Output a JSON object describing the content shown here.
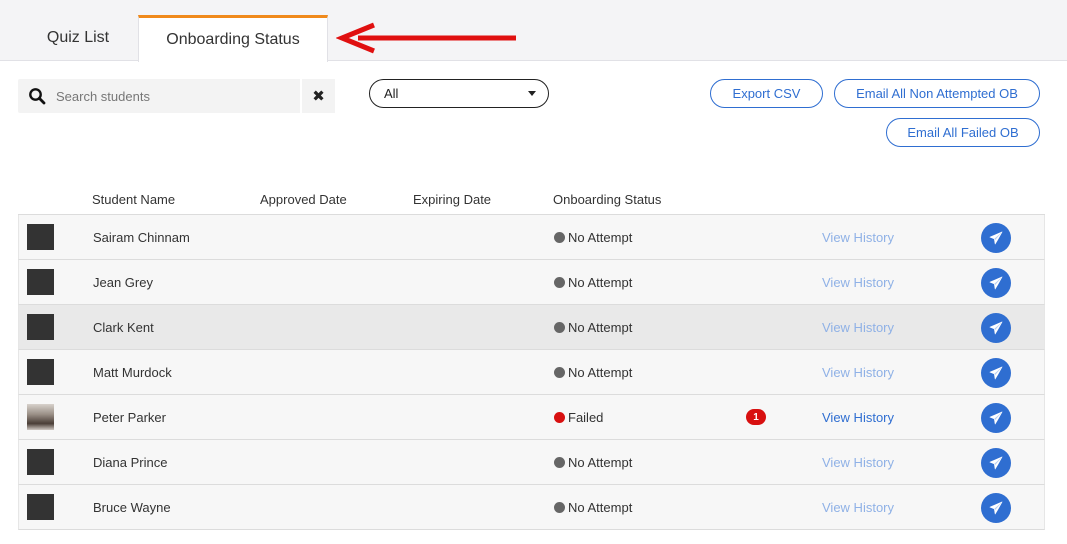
{
  "tabs": [
    {
      "label": "Quiz List",
      "active": false
    },
    {
      "label": "Onboarding Status",
      "active": true
    }
  ],
  "search": {
    "placeholder": "Search students",
    "value": "",
    "clear_icon": "close-icon"
  },
  "filter": {
    "selected": "All"
  },
  "actions": {
    "export_csv": "Export CSV",
    "email_non_attempted": "Email All Non Attempted OB",
    "email_failed": "Email All Failed OB"
  },
  "table": {
    "headers": [
      "Student Name",
      "Approved Date",
      "Expiring Date",
      "Onboarding Status"
    ],
    "rows": [
      {
        "name": "Sairam Chinnam",
        "approved": "",
        "expiring": "",
        "status": "No Attempt",
        "status_color": "#666666",
        "history": "View History",
        "history_active": false,
        "badge": "",
        "avatar": "placeholder"
      },
      {
        "name": "Jean Grey",
        "approved": "",
        "expiring": "",
        "status": "No Attempt",
        "status_color": "#666666",
        "history": "View History",
        "history_active": false,
        "badge": "",
        "avatar": "placeholder"
      },
      {
        "name": "Clark Kent",
        "approved": "",
        "expiring": "",
        "status": "No Attempt",
        "status_color": "#666666",
        "history": "View History",
        "history_active": false,
        "badge": "",
        "avatar": "placeholder",
        "highlight": true
      },
      {
        "name": "Matt Murdock",
        "approved": "",
        "expiring": "",
        "status": "No Attempt",
        "status_color": "#666666",
        "history": "View History",
        "history_active": false,
        "badge": "",
        "avatar": "placeholder"
      },
      {
        "name": "Peter Parker",
        "approved": "",
        "expiring": "",
        "status": "Failed",
        "status_color": "#d81010",
        "history": "View History",
        "history_active": true,
        "badge": "1",
        "avatar": "photo"
      },
      {
        "name": "Diana Prince",
        "approved": "",
        "expiring": "",
        "status": "No Attempt",
        "status_color": "#666666",
        "history": "View History",
        "history_active": false,
        "badge": "",
        "avatar": "placeholder"
      },
      {
        "name": "Bruce Wayne",
        "approved": "",
        "expiring": "",
        "status": "No Attempt",
        "status_color": "#666666",
        "history": "View History",
        "history_active": false,
        "badge": "",
        "avatar": "placeholder"
      }
    ]
  },
  "colors": {
    "accent_tab": "#f08a1c",
    "primary": "#2f6ed1",
    "link_active": "#2f6ed1",
    "link_inactive": "#8fb1e6",
    "failed": "#d81010",
    "no_attempt": "#666666",
    "annotation_arrow": "#e01010"
  },
  "icons": {
    "search": "search-icon",
    "send": "paper-plane-icon",
    "dropdown": "caret-down-icon",
    "annotation": "red-arrow-icon"
  }
}
